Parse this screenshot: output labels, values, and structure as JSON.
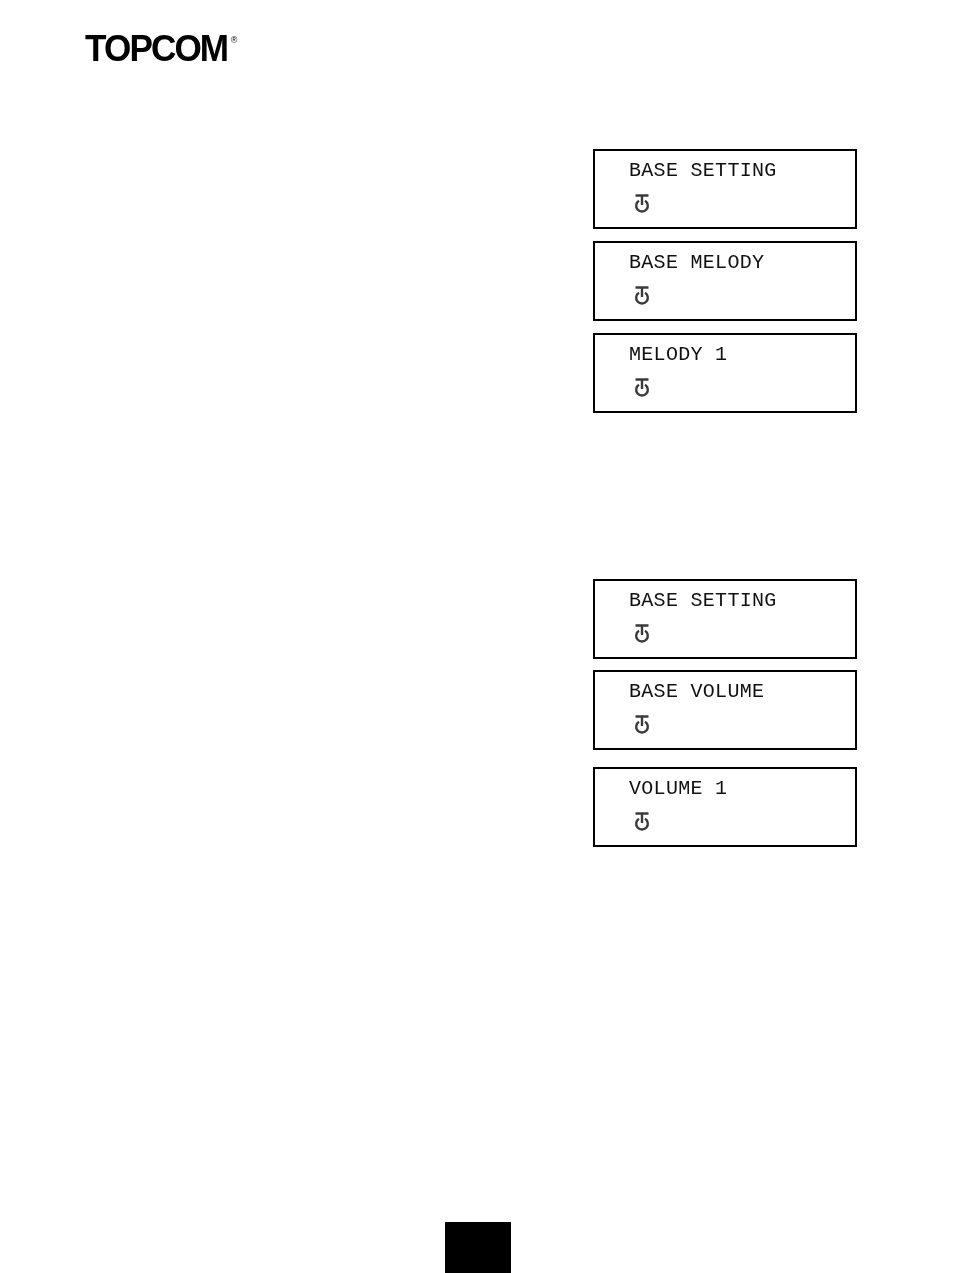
{
  "header": {
    "logo": "TOPCOM",
    "registered_mark": "®"
  },
  "sections": [
    {
      "screens": [
        {
          "text": "BASE SETTING"
        },
        {
          "text": "BASE MELODY"
        },
        {
          "text": "MELODY 1"
        }
      ]
    },
    {
      "screens": [
        {
          "text": "BASE SETTING"
        },
        {
          "text": "BASE VOLUME"
        },
        {
          "text": "VOLUME 1"
        }
      ]
    }
  ]
}
